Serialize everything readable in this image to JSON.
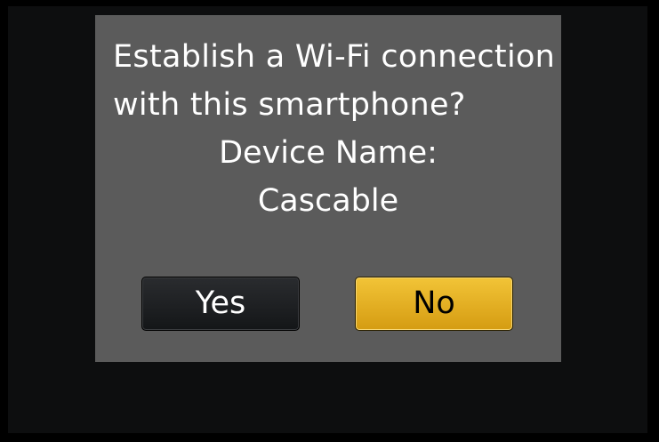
{
  "dialog": {
    "message_lines": [
      "Establish a Wi-Fi connection",
      "with this smartphone?"
    ],
    "device_label": "Device Name:",
    "device_name": "Cascable"
  },
  "buttons": {
    "yes_label": "Yes",
    "no_label": "No"
  },
  "colors": {
    "dialog_bg": "#5b5b5b",
    "screen_bg": "#0d0e0f",
    "yes_button": "#1c1e21",
    "no_button_selected": "#e5b42a",
    "text": "#ffffff"
  }
}
